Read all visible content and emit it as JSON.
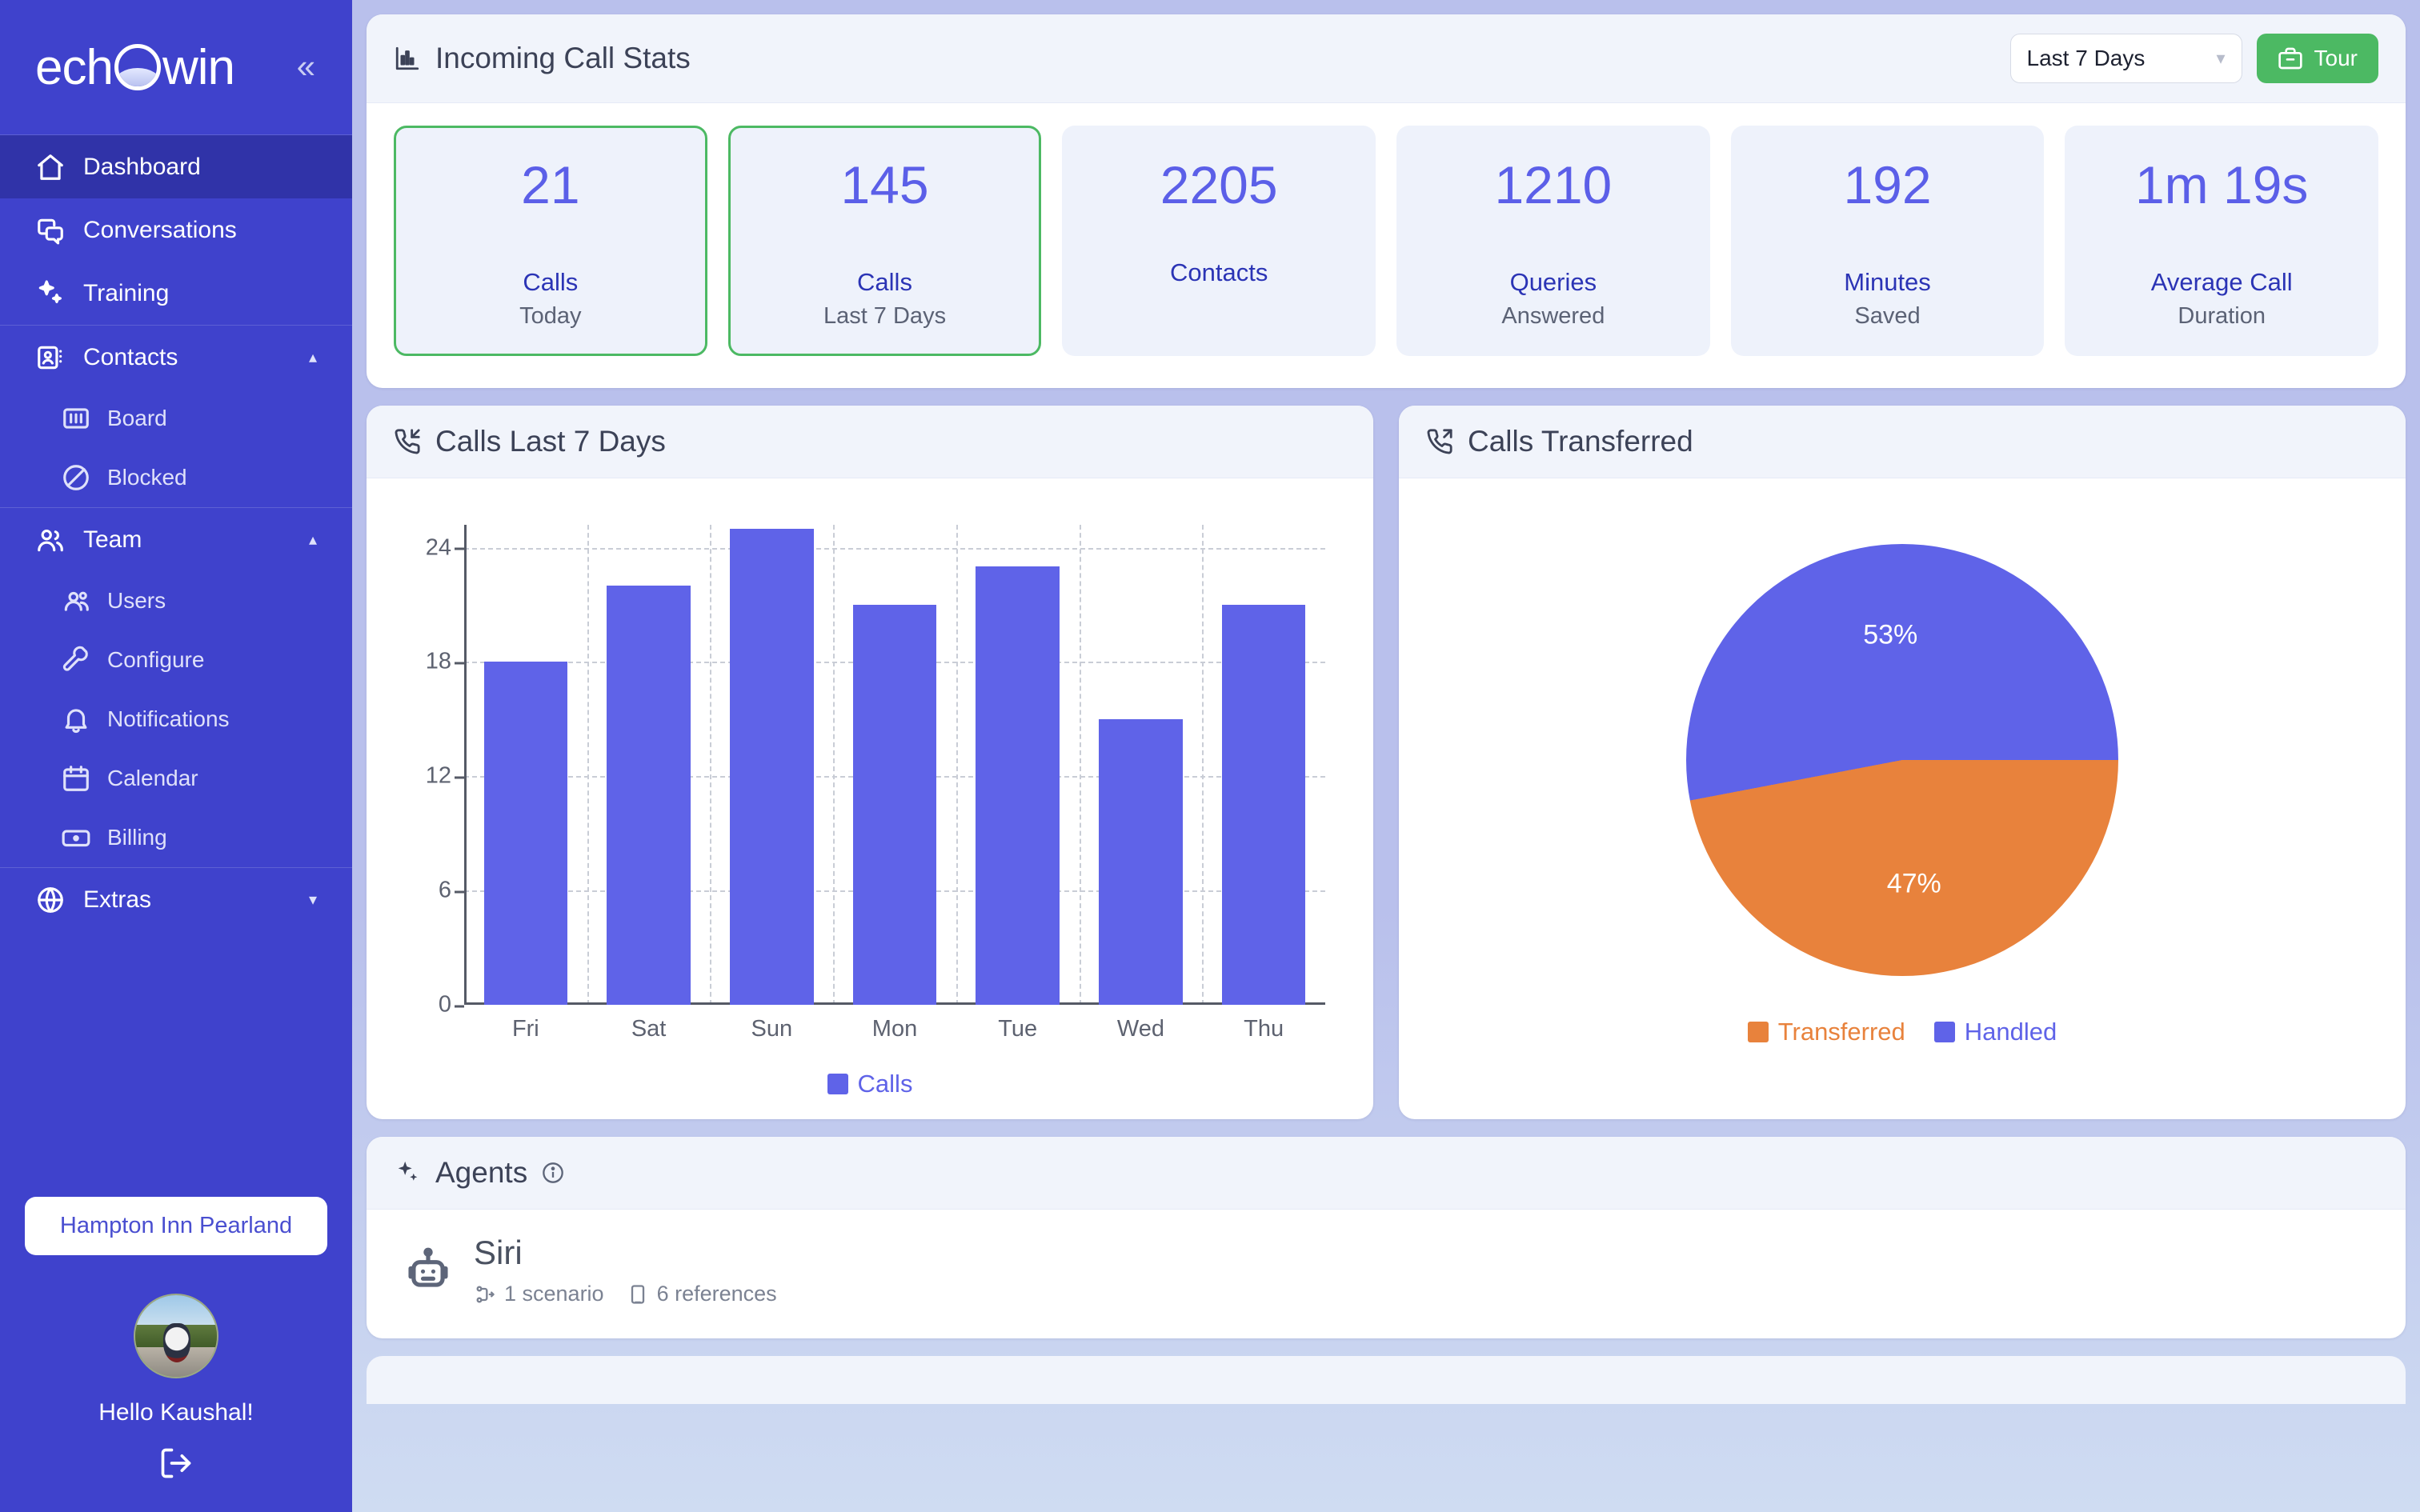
{
  "brand": {
    "name": "echowin",
    "collapse_icon": "chevrons-left-icon"
  },
  "sidebar": {
    "items": [
      {
        "label": "Dashboard",
        "icon": "home-icon",
        "active": true,
        "type": "item"
      },
      {
        "label": "Conversations",
        "icon": "chat-bubbles-icon",
        "active": false,
        "type": "item"
      },
      {
        "label": "Training",
        "icon": "sparkles-icon",
        "active": false,
        "type": "item"
      },
      {
        "label": "Contacts",
        "icon": "contact-card-icon",
        "active": false,
        "type": "group",
        "expanded": true,
        "chevron": "chevron-up-icon"
      },
      {
        "label": "Board",
        "icon": "board-icon",
        "active": false,
        "type": "sub"
      },
      {
        "label": "Blocked",
        "icon": "block-icon",
        "active": false,
        "type": "sub"
      },
      {
        "label": "Team",
        "icon": "team-icon",
        "active": false,
        "type": "group",
        "expanded": true,
        "chevron": "chevron-up-icon"
      },
      {
        "label": "Users",
        "icon": "users-icon",
        "active": false,
        "type": "sub"
      },
      {
        "label": "Configure",
        "icon": "wrench-icon",
        "active": false,
        "type": "sub"
      },
      {
        "label": "Notifications",
        "icon": "bell-icon",
        "active": false,
        "type": "sub"
      },
      {
        "label": "Calendar",
        "icon": "calendar-icon",
        "active": false,
        "type": "sub"
      },
      {
        "label": "Billing",
        "icon": "banknote-icon",
        "active": false,
        "type": "sub"
      },
      {
        "label": "Extras",
        "icon": "globe-icon",
        "active": false,
        "type": "group",
        "expanded": false,
        "chevron": "chevron-down-icon"
      }
    ],
    "org_name": "Hampton Inn Pearland",
    "greeting": "Hello Kaushal!",
    "logout_icon": "logout-icon",
    "avatar_alt": "user-avatar"
  },
  "stats_card": {
    "title": "Incoming Call Stats",
    "title_icon": "bar-chart-icon",
    "range_select": {
      "value": "Last 7 Days",
      "chevron": "chevron-down-icon"
    },
    "tour_button": {
      "label": "Tour",
      "icon": "briefcase-icon",
      "color": "#4cb963"
    },
    "stats": [
      {
        "value": "21",
        "label": "Calls",
        "sublabel": "Today",
        "highlight": true
      },
      {
        "value": "145",
        "label": "Calls",
        "sublabel": "Last 7 Days",
        "highlight": true
      },
      {
        "value": "2205",
        "label": "Contacts",
        "sublabel": "",
        "highlight": false
      },
      {
        "value": "1210",
        "label": "Queries",
        "sublabel": "Answered",
        "highlight": false
      },
      {
        "value": "192",
        "label": "Minutes",
        "sublabel": "Saved",
        "highlight": false
      },
      {
        "value": "1m 19s",
        "label": "Average Call",
        "sublabel": "Duration",
        "highlight": false
      }
    ]
  },
  "bar_card": {
    "title": "Calls Last 7 Days",
    "title_icon": "phone-incoming-icon"
  },
  "pie_card": {
    "title": "Calls Transferred",
    "title_icon": "phone-outgoing-icon"
  },
  "agents_card": {
    "title": "Agents",
    "title_icon": "sparkles-icon",
    "info_icon": "info-circle-icon",
    "agents": [
      {
        "name": "Siri",
        "avatar_icon": "robot-icon",
        "scenarios": "1 scenario",
        "scenarios_icon": "workflow-icon",
        "references": "6 references",
        "references_icon": "document-icon"
      }
    ]
  },
  "chart_data": [
    {
      "type": "bar",
      "title": "Calls Last 7 Days",
      "categories": [
        "Fri",
        "Sat",
        "Sun",
        "Mon",
        "Tue",
        "Wed",
        "Thu"
      ],
      "series": [
        {
          "name": "Calls",
          "values": [
            18,
            22,
            25,
            21,
            23,
            15,
            21
          ],
          "color": "#5f63e8"
        }
      ],
      "xlabel": "",
      "ylabel": "",
      "ylim": [
        0,
        25
      ],
      "yticks": [
        0,
        6,
        12,
        18,
        24
      ],
      "grid": true,
      "legend": "bottom",
      "legend_entries": [
        {
          "label": "Calls",
          "color": "#5f63e8"
        }
      ]
    },
    {
      "type": "pie",
      "title": "Calls Transferred",
      "labels": [
        "Transferred",
        "Handled"
      ],
      "values": [
        47,
        53
      ],
      "value_labels": [
        "47%",
        "53%"
      ],
      "colors": [
        "#e8823c",
        "#5f63e8"
      ],
      "legend": "bottom",
      "legend_entries": [
        {
          "label": "Transferred",
          "color": "#e8823c"
        },
        {
          "label": "Handled",
          "color": "#5f63e8"
        }
      ]
    }
  ]
}
